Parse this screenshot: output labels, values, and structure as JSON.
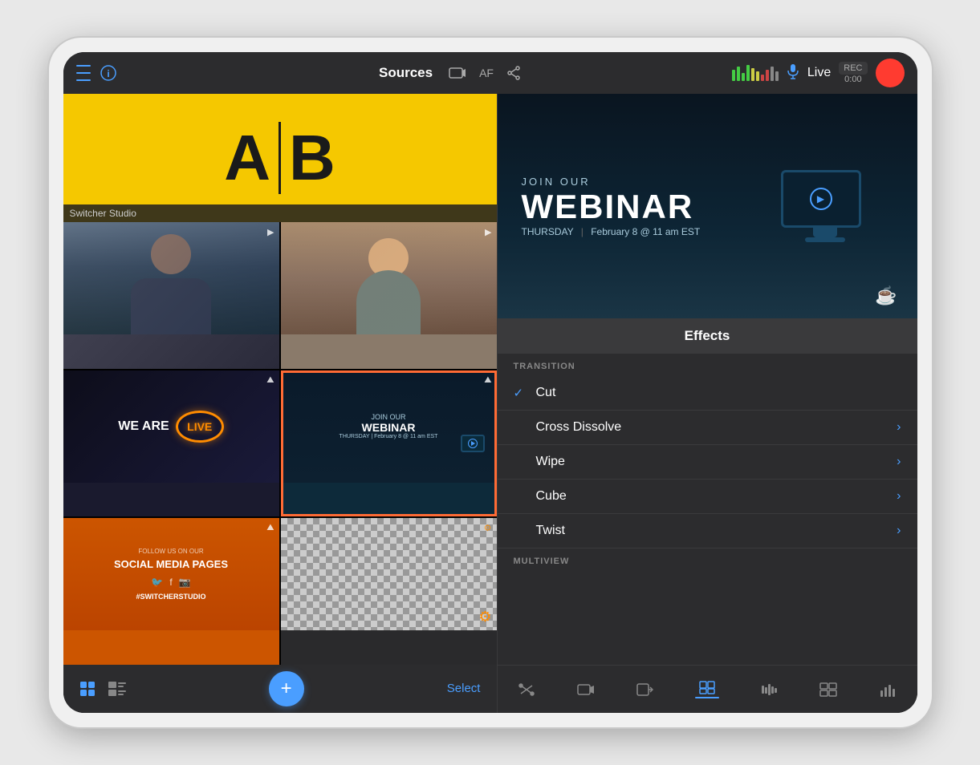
{
  "tablet": {
    "header": {
      "title": "Sources",
      "af_label": "AF",
      "live_label": "Live",
      "rec_label": "REC",
      "rec_time": "0:00"
    },
    "left_panel": {
      "switcher_label": "Switcher Studio",
      "ab_labels": {
        "a": "A",
        "b": "B"
      },
      "add_button_label": "+",
      "select_button_label": "Select",
      "grid_cells": [
        {
          "id": "cam1",
          "type": "camera",
          "badge": "▶",
          "selected": false
        },
        {
          "id": "cam2",
          "type": "camera",
          "badge": "▶",
          "selected": false
        },
        {
          "id": "we-are-live",
          "type": "graphic",
          "badge": "⛰",
          "selected": false
        },
        {
          "id": "webinar",
          "type": "graphic",
          "badge": "⛰",
          "selected": true
        },
        {
          "id": "social",
          "type": "graphic",
          "badge": "⛰",
          "selected": false
        },
        {
          "id": "transparent",
          "type": "transparent",
          "badge": "⚙",
          "selected": false
        }
      ]
    },
    "right_panel": {
      "preview": {
        "join_our": "JOIN OUR",
        "webinar_title": "WEBINAR",
        "thursday_label": "THURSDAY",
        "date_label": "February 8 @ 11 am EST"
      },
      "effects": {
        "header": "Effects",
        "transition_label": "TRANSITION",
        "items": [
          {
            "id": "cut",
            "label": "Cut",
            "checked": true,
            "has_detail": false
          },
          {
            "id": "cross-dissolve",
            "label": "Cross Dissolve",
            "checked": false,
            "has_detail": true
          },
          {
            "id": "wipe",
            "label": "Wipe",
            "checked": false,
            "has_detail": true
          },
          {
            "id": "cube",
            "label": "Cube",
            "checked": false,
            "has_detail": true
          },
          {
            "id": "twist",
            "label": "Twist",
            "checked": false,
            "has_detail": true
          }
        ],
        "multiview_label": "MULTIVIEW"
      },
      "toolbar_items": [
        {
          "id": "mixer",
          "icon": "⇄",
          "active": false
        },
        {
          "id": "camera",
          "icon": "📹",
          "active": false
        },
        {
          "id": "output",
          "icon": "⬛",
          "active": false
        },
        {
          "id": "effects",
          "icon": "⬚",
          "active": true
        },
        {
          "id": "audio",
          "icon": "|||",
          "active": false
        },
        {
          "id": "multiview",
          "icon": "⊞",
          "active": false
        },
        {
          "id": "stats",
          "icon": "📊",
          "active": false
        }
      ]
    }
  }
}
